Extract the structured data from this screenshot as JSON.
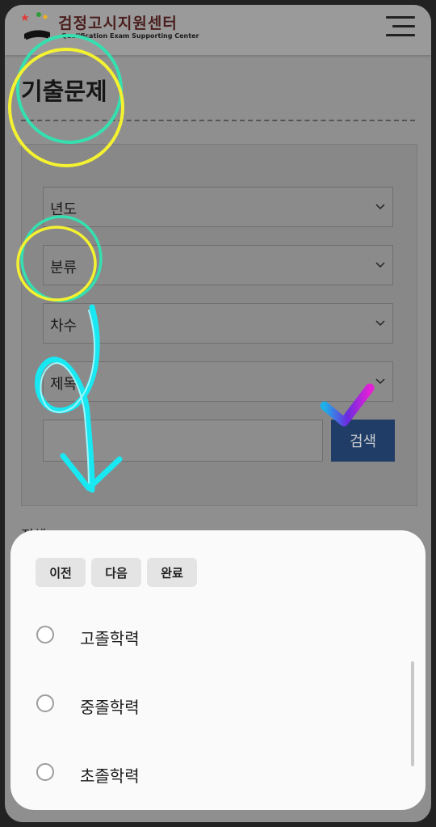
{
  "header": {
    "logo_ko": "검정고시지원센터",
    "logo_en": "Qualification Exam Supporting Center",
    "menu_icon": "hamburger-menu-icon"
  },
  "page_title": "기출문제",
  "filters": [
    {
      "label": "년도"
    },
    {
      "label": "분류"
    },
    {
      "label": "차수"
    },
    {
      "label": "제목"
    }
  ],
  "search": {
    "value": "",
    "button_label": "검색",
    "button_color": "#1f3d66"
  },
  "behind_text": "전체",
  "picker": {
    "prev_label": "이전",
    "next_label": "다음",
    "done_label": "완료",
    "options": [
      {
        "label": "고졸학력",
        "selected": false
      },
      {
        "label": "중졸학력",
        "selected": false
      },
      {
        "label": "초졸학력",
        "selected": false
      }
    ]
  }
}
